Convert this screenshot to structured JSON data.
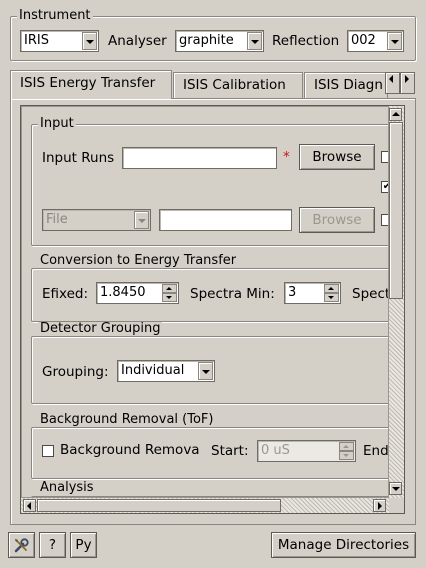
{
  "instrument_group": {
    "title": "Instrument",
    "instrument_label": "",
    "instrument_value": "IRIS",
    "analyser_label": "Analyser",
    "analyser_value": "graphite",
    "reflection_label": "Reflection",
    "reflection_value": "002"
  },
  "tabs": [
    {
      "label": "ISIS Energy Transfer",
      "active": true
    },
    {
      "label": "ISIS Calibration",
      "active": false
    },
    {
      "label": "ISIS Diagn",
      "active": false
    }
  ],
  "input": {
    "title": "Input",
    "input_runs_label": "Input Runs",
    "input_runs_value": "",
    "required_marker": "*",
    "browse_label": "Browse",
    "file_type_value": "File",
    "file_value": "",
    "browse2_label": "Browse",
    "check_mark": "✔"
  },
  "conversion": {
    "title": "Conversion to Energy Transfer",
    "efixed_label": "Efixed:",
    "efixed_value": "1.8450",
    "spectra_min_label": "Spectra Min:",
    "spectra_min_value": "3",
    "spectra_max_label_partial": "Spect"
  },
  "grouping": {
    "title": "Detector Grouping",
    "grouping_label": "Grouping:",
    "grouping_value": "Individual"
  },
  "background": {
    "title": "Background Removal (ToF)",
    "checkbox_label": "Background Remova",
    "start_label": "Start:",
    "start_value": "0 uS",
    "end_label_partial": "End"
  },
  "analysis": {
    "title": "Analysis"
  },
  "footer": {
    "tools_icon": "wrench-screwdriver-icon",
    "help_label": "?",
    "python_label": "Py",
    "manage_directories_label": "Manage Directories"
  }
}
